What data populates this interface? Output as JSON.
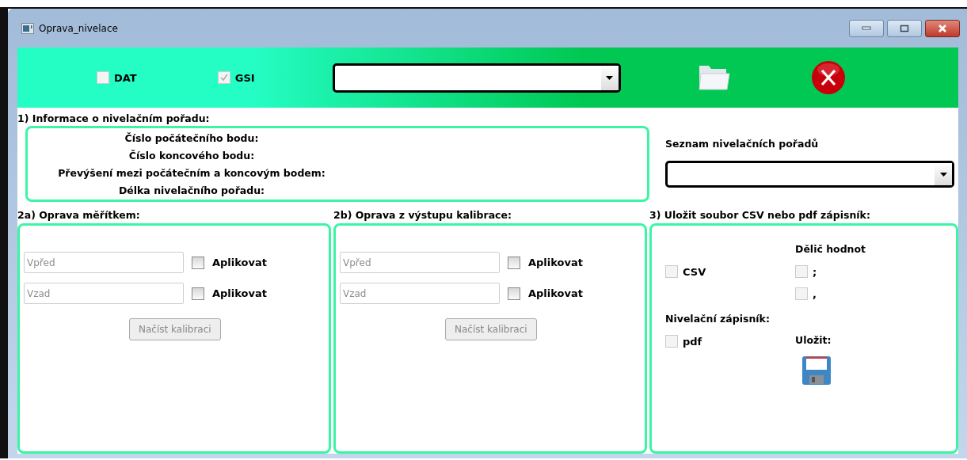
{
  "window": {
    "title": "Oprava_nivelace"
  },
  "toolbar": {
    "checkboxes": [
      {
        "label": "DAT",
        "checked": false,
        "disabled": true
      },
      {
        "label": "GSI",
        "checked": true,
        "disabled": true
      }
    ]
  },
  "info": {
    "title": "1) Informace o nivelačním pořadu:",
    "lines": [
      "Číslo počátečního bodu:",
      "Číslo koncového bodu:",
      "Převýšení mezi počátečním a koncovým bodem:",
      "Délka nivelačního pořadu:"
    ]
  },
  "route_list": {
    "label": "Seznam nivelačních pořadů"
  },
  "corrections": [
    {
      "title": "2a) Oprava měřítkem:",
      "fields": [
        {
          "placeholder": "Vpřed",
          "apply_label": "Aplikovat",
          "checked": false
        },
        {
          "placeholder": "Vzad",
          "apply_label": "Aplikovat",
          "checked": false
        }
      ],
      "button": {
        "label": "Načíst kalibraci",
        "disabled": true
      }
    },
    {
      "title": "2b) Oprava z výstupu kalibrace:",
      "fields": [
        {
          "placeholder": "Vpřed",
          "apply_label": "Aplikovat",
          "checked": false
        },
        {
          "placeholder": "Vzad",
          "apply_label": "Aplikovat",
          "checked": false
        }
      ],
      "button": {
        "label": "Načíst kalibraci",
        "disabled": true
      }
    }
  ],
  "save": {
    "title": "3) Uložit soubor CSV nebo pdf zápisník:",
    "csv": {
      "label": "CSV",
      "checked": false,
      "disabled": true
    },
    "divider_title": "Dělič hodnot",
    "separators": [
      {
        "label": ";",
        "checked": false,
        "disabled": true
      },
      {
        "label": ",",
        "checked": false,
        "disabled": true
      }
    ],
    "notebook_title": "Nivelační zápisník:",
    "pdf": {
      "label": "pdf",
      "checked": false,
      "disabled": true
    },
    "save_label": "Uložit:"
  }
}
